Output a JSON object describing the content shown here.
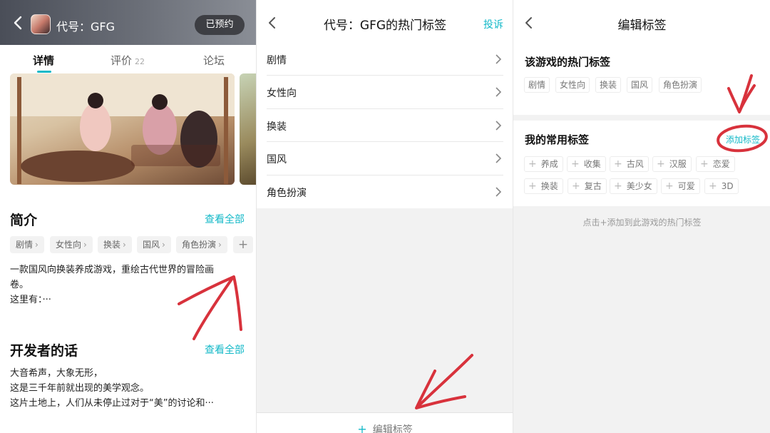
{
  "panel1": {
    "header_title": "代号：GFG",
    "reserved_label": "已预约",
    "tabs": [
      {
        "label": "详情",
        "count": ""
      },
      {
        "label": "评价",
        "count": "22"
      },
      {
        "label": "论坛",
        "count": ""
      }
    ],
    "intro": {
      "title": "简介",
      "see_all": "查看全部",
      "tags": [
        "剧情",
        "女性向",
        "换装",
        "国风",
        "角色扮演"
      ],
      "text_lines": [
        "一款国风向换装养成游戏，重绘古代世界的冒险画",
        "卷。",
        "这里有：···"
      ]
    },
    "dev": {
      "title": "开发者的话",
      "see_all": "查看全部",
      "text_lines": [
        "大音希声，大象无形，",
        "这是三千年前就出现的美学观念。",
        "这片土地上，人们从未停止过对于“美”的讨论和···"
      ]
    }
  },
  "panel2": {
    "title": "代号：GFG的热门标签",
    "report": "投诉",
    "rows": [
      "剧情",
      "女性向",
      "换装",
      "国风",
      "角色扮演"
    ],
    "edit_label": "编辑标签",
    "edit_icon": "+"
  },
  "panel3": {
    "title": "编辑标签",
    "hot_title": "该游戏的热门标签",
    "hot_tags": [
      "剧情",
      "女性向",
      "换装",
      "国风",
      "角色扮演"
    ],
    "common_title": "我的常用标签",
    "add_label": "添加标签",
    "common_tags_row1": [
      "养成",
      "收集",
      "古风",
      "汉服",
      "恋爱"
    ],
    "common_tags_row2": [
      "换装",
      "复古",
      "美少女",
      "可爱",
      "3D"
    ],
    "hint": "点击+添加到此游戏的热门标签"
  },
  "colors": {
    "accent": "#14b9c8",
    "annotation": "#d8323c"
  }
}
